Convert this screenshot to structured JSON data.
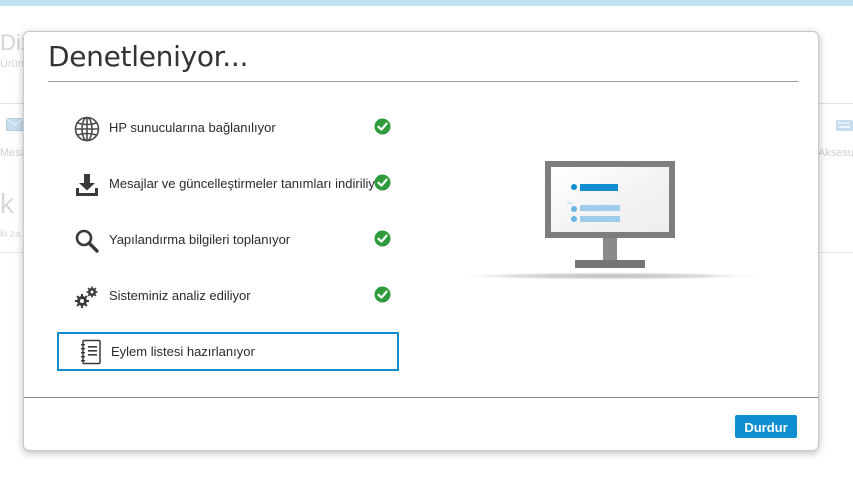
{
  "background": {
    "title": "Diz",
    "subtitle": "Ürün",
    "messages_label": "Mesa",
    "accessories_label": "Aksesu",
    "big_letter": "k",
    "small_label": "ki za"
  },
  "dialog": {
    "title": "Denetleniyor...",
    "steps": [
      {
        "label": "HP sunucularına bağlanılıyor",
        "icon": "globe-icon",
        "done": true
      },
      {
        "label": "Mesajlar ve güncelleştirmeler tanımları indiriliyor",
        "icon": "download-icon",
        "done": true
      },
      {
        "label": "Yapılandırma bilgileri toplanıyor",
        "icon": "magnifier-icon",
        "done": true
      },
      {
        "label": "Sisteminiz analiz ediliyor",
        "icon": "gears-icon",
        "done": true
      },
      {
        "label": "Eylem listesi hazırlanıyor",
        "icon": "notebook-icon",
        "done": false
      }
    ],
    "stop_label": "Durdur"
  },
  "colors": {
    "accent": "#0f8fd2",
    "check_green": "#2e9a3a",
    "top_bar": "#bfe3f4"
  }
}
